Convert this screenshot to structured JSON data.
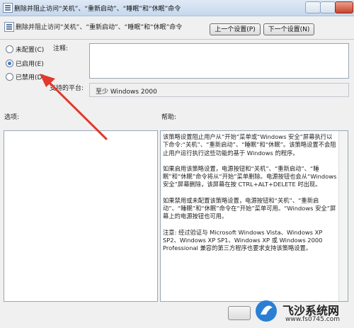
{
  "window": {
    "title": "删除并阻止访问“关机”、“重新启动”、“睡眠”和“休眠”命令"
  },
  "header": {
    "policy_name": "删除并阻止访问“关机”、“重新启动”、“睡眠”和“休眠”命令",
    "prev_button": "上一个设置(P)",
    "next_button": "下一个设置(N)"
  },
  "state": {
    "options": [
      {
        "label": "未配置(C)",
        "checked": false
      },
      {
        "label": "已启用(E)",
        "checked": true
      },
      {
        "label": "已禁用(D)",
        "checked": false
      }
    ]
  },
  "comment": {
    "label": "注释:",
    "value": ""
  },
  "platform": {
    "label": "支持的平台:",
    "value": "至少 Windows 2000"
  },
  "options_panel": {
    "label": "选项:"
  },
  "help_panel": {
    "label": "帮助:",
    "paragraphs": [
      "该策略设置阻止用户从“开始”菜单或“Windows 安全”屏幕执行以下命令:“关机”、“重新启动”、“睡眠”和“休眠”。该策略设置不会阻止用户运行执行这些功能的基于 Windows 的程序。",
      "如果启用该策略设置，电源按钮和“关机”、“重新启动”、“睡眠”和“休眠”命令将从“开始”菜单删除。电源按钮也会从“Windows 安全”屏幕删除，该屏幕在按 CTRL+ALT+DELETE 时出现。",
      "如果禁用或未配置该策略设置，电源按钮和“关机”、“重新启动”、“睡眠”和“休眠”命令在“开始”菜单可用。“Windows 安全”屏幕上的电源按钮也可用。",
      "注意: 经过验证与 Microsoft Windows Vista、Windows XP SP2、Windows XP SP1、Windows XP 或 Windows 2000 Professional 兼容的第三方程序也要求支持该策略设置。"
    ]
  },
  "watermark": {
    "title": "飞沙系统网",
    "url": "www.fs0745.com"
  },
  "colors": {
    "arrow": "#e03a2e",
    "accent": "#3d7ad6"
  },
  "icons": {
    "title": "policy-icon",
    "arrow": "red-arrow"
  }
}
